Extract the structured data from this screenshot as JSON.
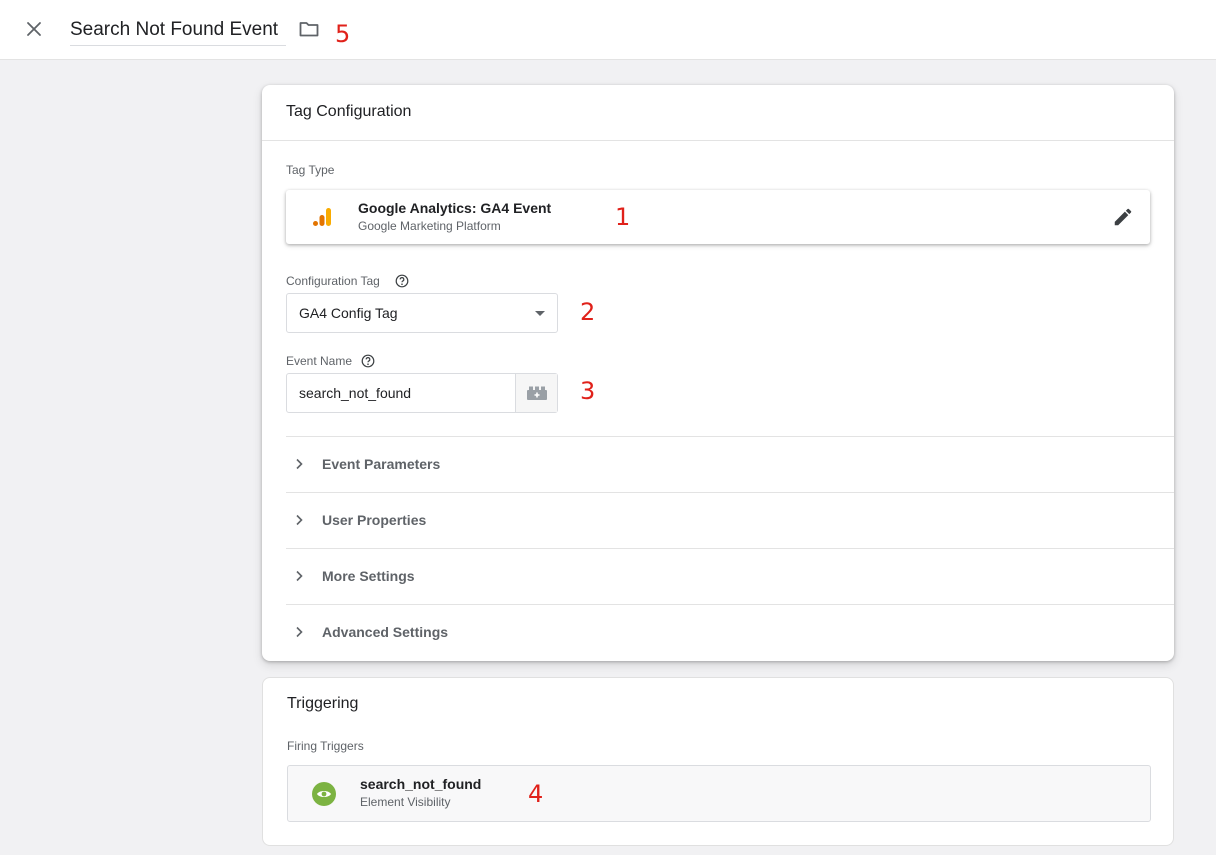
{
  "header": {
    "title_value": "Search Not Found Event"
  },
  "annotations": {
    "a1": "1",
    "a2": "2",
    "a3": "3",
    "a4": "4",
    "a5": "5"
  },
  "tag_configuration": {
    "heading": "Tag Configuration",
    "tag_type_label": "Tag Type",
    "tag_type": {
      "name": "Google Analytics: GA4 Event",
      "vendor": "Google Marketing Platform"
    },
    "config_tag_label": "Configuration Tag",
    "config_tag_value": "GA4 Config Tag",
    "event_name_label": "Event Name",
    "event_name_value": "search_not_found",
    "sections": [
      {
        "label": "Event Parameters"
      },
      {
        "label": "User Properties"
      },
      {
        "label": "More Settings"
      },
      {
        "label": "Advanced Settings"
      }
    ]
  },
  "triggering": {
    "heading": "Triggering",
    "firing_label": "Firing Triggers",
    "trigger": {
      "name": "search_not_found",
      "type": "Element Visibility"
    }
  },
  "colors": {
    "annotation": "#e0211a",
    "trigger_icon": "#7cb342",
    "ga_dark": "#e37400",
    "ga_light": "#f9ab00"
  }
}
